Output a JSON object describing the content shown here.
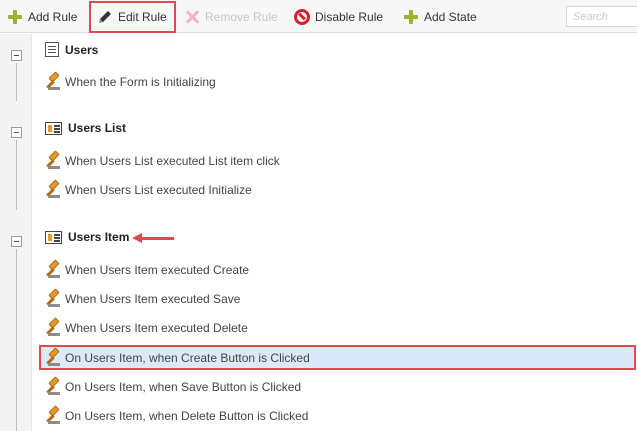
{
  "toolbar": {
    "add_rule": "Add Rule",
    "edit_rule": "Edit Rule",
    "remove_rule": "Remove Rule",
    "disable_rule": "Disable Rule",
    "add_state": "Add State",
    "search_placeholder": "Search"
  },
  "tree": {
    "groups": [
      {
        "name": "Users",
        "icon": "form-icon",
        "rules": [
          "When the Form is Initializing"
        ]
      },
      {
        "name": "Users List",
        "icon": "list-view-icon",
        "rules": [
          "When Users List executed List item click",
          "When Users List executed Initialize"
        ]
      },
      {
        "name": "Users Item",
        "icon": "list-view-icon",
        "rules": [
          "When Users Item executed Create",
          "When Users Item executed Save",
          "When Users Item executed Delete",
          "On Users Item, when Create Button is Clicked",
          "On Users Item, when Save Button is Clicked",
          "On Users Item, when Delete Button is Clicked"
        ]
      }
    ],
    "selected_rule": "On Users Item, when Create Button is Clicked"
  },
  "colors": {
    "highlight": "#e04a4f",
    "selection": "#dce9f9",
    "add_icon": "#97b431",
    "disable_icon": "#d4232f",
    "rule_icon": "#e49a2a"
  }
}
